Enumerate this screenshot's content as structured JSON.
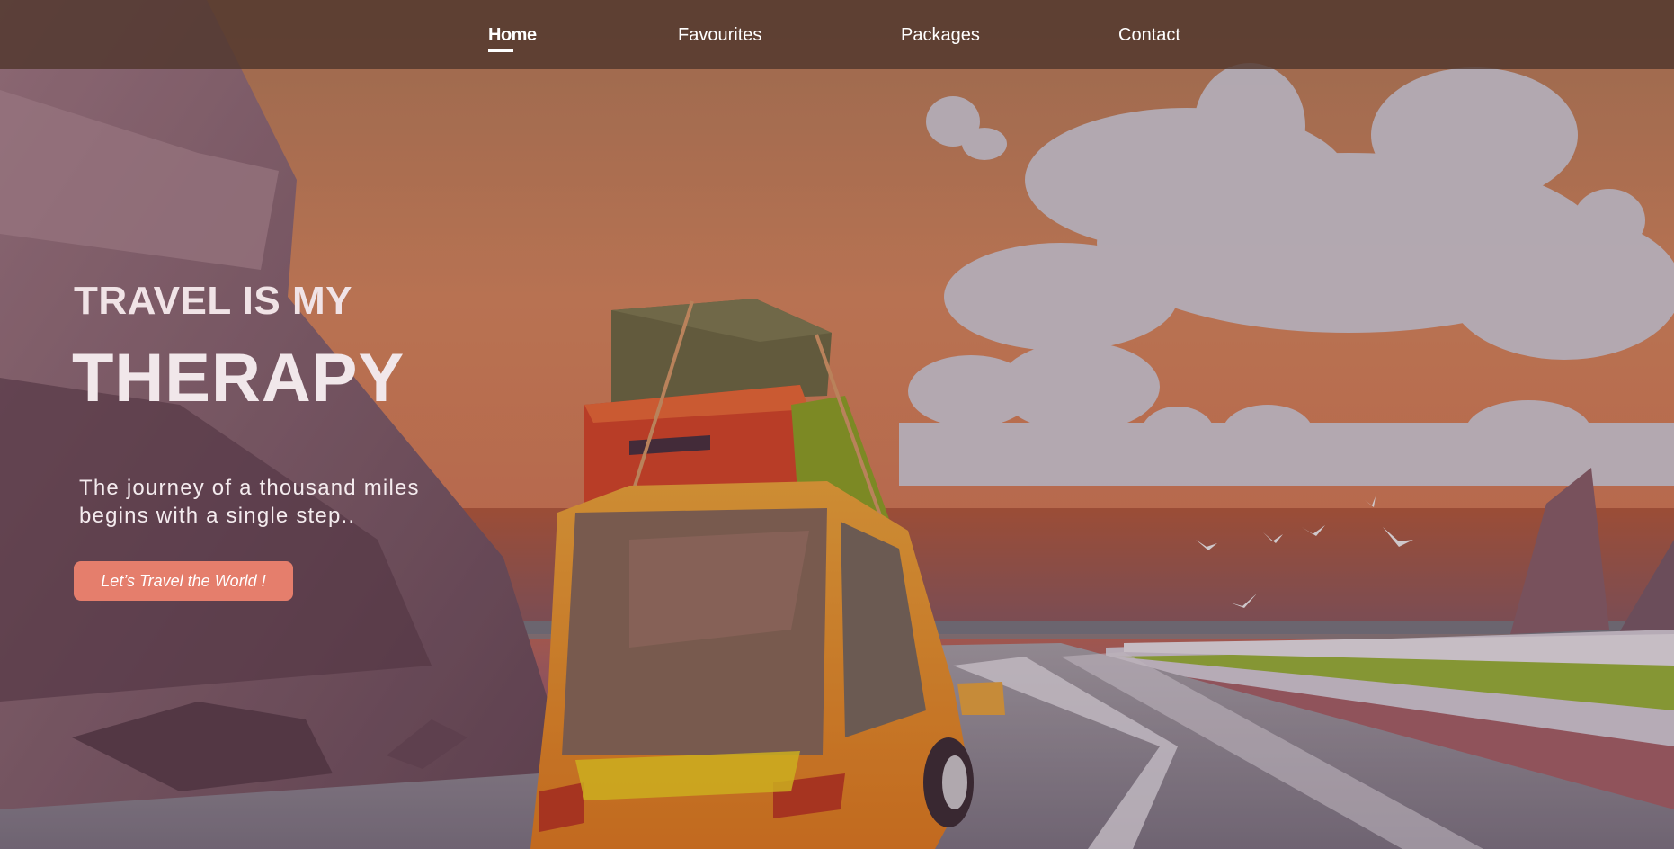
{
  "nav": {
    "items": [
      {
        "label": "Home",
        "active": true
      },
      {
        "label": "Favourites",
        "active": false
      },
      {
        "label": "Packages",
        "active": false
      },
      {
        "label": "Contact",
        "active": false
      }
    ]
  },
  "hero": {
    "kicker": "TRAVEL IS MY",
    "title": "THERAPY",
    "subtitle": "The journey of a thousand miles begins with a single step..",
    "cta_label": "Let’s Travel the World !"
  },
  "theme": {
    "nav_bg": "#50372d",
    "cta_bg": "#e57e6c",
    "text": "#ffffff"
  },
  "background": {
    "icon": "car-road-trip-illustration"
  }
}
